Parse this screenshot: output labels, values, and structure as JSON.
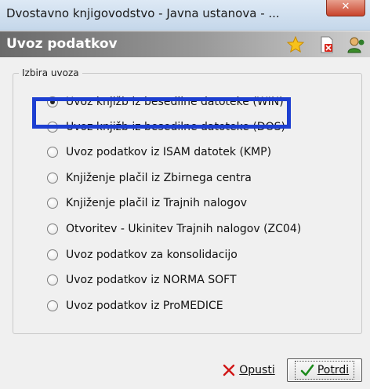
{
  "window": {
    "title": "Dvostavno knjigovodstvo - Javna ustanova - ...",
    "close_symbol": "✕"
  },
  "header": {
    "title": "Uvoz podatkov",
    "icons": [
      "star-icon",
      "document-delete-icon",
      "person-icon"
    ]
  },
  "group": {
    "legend": "Izbira uvoza",
    "options": [
      {
        "label": "Uvoz knjižb iz besedilne datoteke (WIN)",
        "checked": true
      },
      {
        "label": "Uvoz knjižb iz besedilne datoteke (DOS)",
        "checked": false
      },
      {
        "label": "Uvoz podatkov iz ISAM datotek (KMP)",
        "checked": false
      },
      {
        "label": "Knjiženje plačil iz Zbirnega centra",
        "checked": false
      },
      {
        "label": "Knjiženje plačil iz Trajnih nalogov",
        "checked": false
      },
      {
        "label": "Otvoritev - Ukinitev Trajnih nalogov (ZC04)",
        "checked": false
      },
      {
        "label": "Uvoz podatkov za konsolidacijo",
        "checked": false
      },
      {
        "label": "Uvoz podatkov iz NORMA SOFT",
        "checked": false
      },
      {
        "label": "Uvoz podatkov iz ProMEDICE",
        "checked": false
      }
    ]
  },
  "buttons": {
    "cancel_label": "Opusti",
    "ok_label": "Potrdi"
  },
  "colors": {
    "highlight": "#1d3fd1",
    "cancel_icon": "#d01515",
    "ok_icon": "#1a8a1a"
  }
}
